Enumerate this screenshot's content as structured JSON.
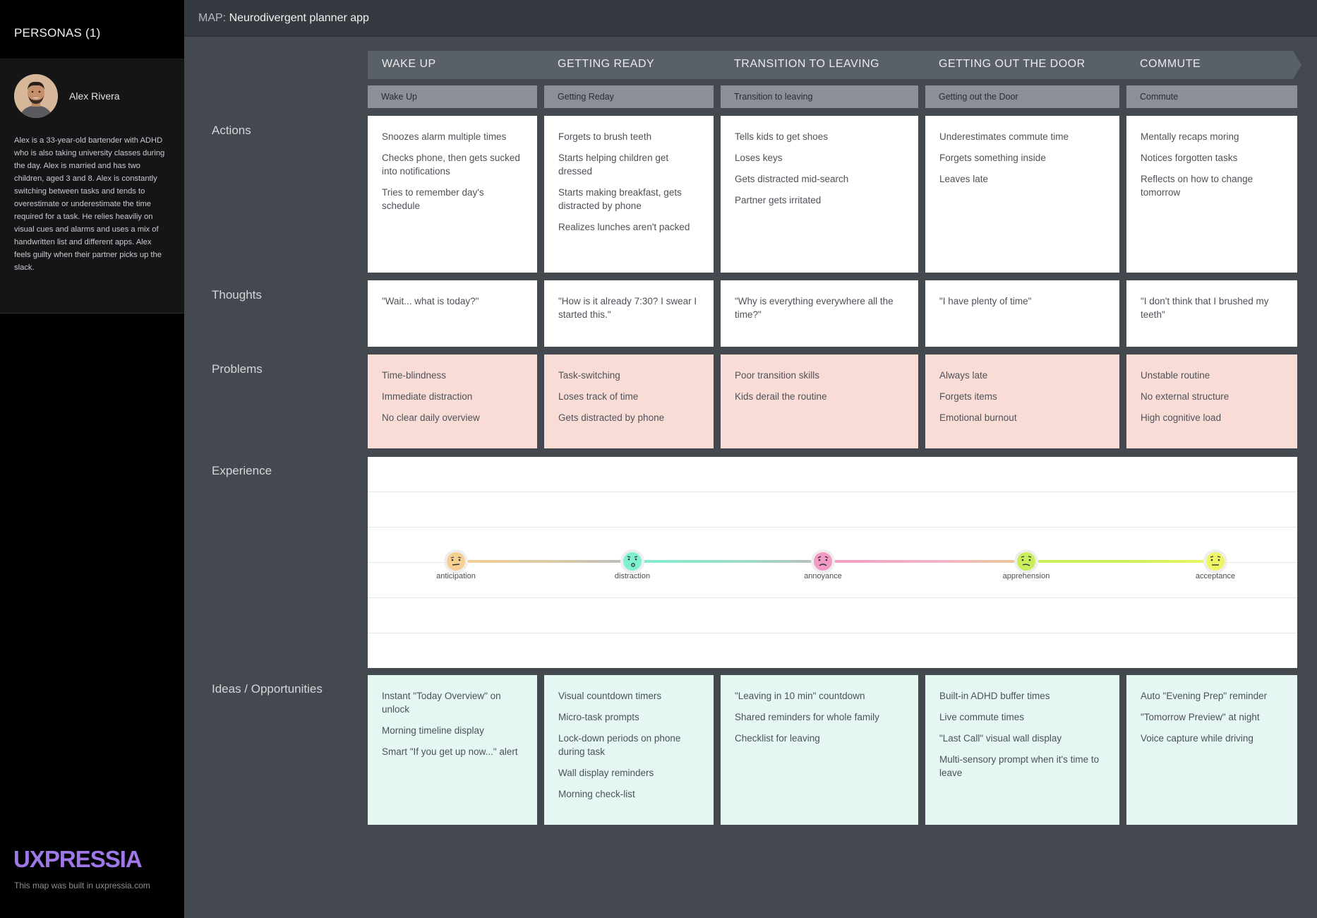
{
  "sidebar": {
    "title": "PERSONAS (1)",
    "persona": {
      "name": "Alex Rivera",
      "bio": "Alex is a 33-year-old bartender with ADHD who is also taking university classes during the day. Alex is married and has two children, aged 3 and 8. Alex is constantly switching between tasks and tends to overestimate or underestimate the time required for a task. He relies heaviliy on visual cues and alarms and uses a mix of handwritten list and different apps. Alex feels guilty when their partner picks up the slack."
    },
    "logo": "UXPRESSIA",
    "logo_sub": "This map was built in uxpressia.com"
  },
  "topbar": {
    "label": "MAP:",
    "name": "Neurodivergent planner app"
  },
  "stages": [
    {
      "title": "WAKE UP",
      "sub": "Wake Up"
    },
    {
      "title": "GETTING READY",
      "sub": "Getting Reday"
    },
    {
      "title": "TRANSITION TO LEAVING",
      "sub": "Transition to leaving"
    },
    {
      "title": "GETTING OUT THE DOOR",
      "sub": "Getting out the Door"
    },
    {
      "title": "COMMUTE",
      "sub": "Commute"
    }
  ],
  "rows": {
    "actions": {
      "label": "Actions",
      "cells": [
        [
          "Snoozes alarm multiple times",
          "Checks phone, then gets sucked into notifications",
          "Tries to remember day's schedule"
        ],
        [
          "Forgets to brush teeth",
          "Starts helping children get dressed",
          "Starts making breakfast, gets distracted by phone",
          "Realizes lunches aren't packed"
        ],
        [
          "Tells kids to get shoes",
          "Loses keys",
          "Gets distracted mid-search",
          "Partner gets irritated"
        ],
        [
          "Underestimates commute time",
          "Forgets something inside",
          "Leaves late"
        ],
        [
          "Mentally recaps moring",
          "Notices forgotten tasks",
          "Reflects on how to change tomorrow"
        ]
      ]
    },
    "thoughts": {
      "label": "Thoughts",
      "cells": [
        [
          "\"Wait... what is today?\""
        ],
        [
          "\"How is it already 7:30? I swear I started this.\""
        ],
        [
          "\"Why is everything everywhere all the time?\""
        ],
        [
          "\"I have plenty of time\""
        ],
        [
          "\"I don't think that I brushed my teeth\""
        ]
      ]
    },
    "problems": {
      "label": "Problems",
      "cells": [
        [
          "Time-blindness",
          "Immediate distraction",
          "No clear daily overview"
        ],
        [
          "Task-switching",
          "Loses track of time",
          "Gets distracted by phone"
        ],
        [
          "Poor transition skills",
          "Kids derail the routine"
        ],
        [
          "Always late",
          "Forgets items",
          "Emotional burnout"
        ],
        [
          "Unstable routine",
          "No external structure",
          "High cognitive load"
        ]
      ]
    },
    "experience": {
      "label": "Experience",
      "emotions": [
        {
          "label": "anticipation",
          "color": "#f5cf93"
        },
        {
          "label": "distraction",
          "color": "#7ef0d0"
        },
        {
          "label": "annoyance",
          "color": "#f39ac4"
        },
        {
          "label": "apprehension",
          "color": "#c8ee5a"
        },
        {
          "label": "acceptance",
          "color": "#eef567"
        }
      ]
    },
    "ideas": {
      "label": "Ideas / Opportunities",
      "cells": [
        [
          "Instant \"Today Overview\" on unlock",
          "Morning timeline display",
          "Smart \"If you get up now...\" alert"
        ],
        [
          "Visual countdown timers",
          "Micro-task prompts",
          "Lock-down periods on phone during task",
          "Wall display reminders",
          "Morning check-list"
        ],
        [
          "\"Leaving in 10 min\" countdown",
          "Shared reminders for whole family",
          "Checklist for leaving"
        ],
        [
          "Built-in ADHD buffer times",
          "Live commute times",
          "\"Last Call\" visual wall display",
          "Multi-sensory prompt when it's time to leave"
        ],
        [
          "Auto \"Evening Prep\" reminder",
          "\"Tomorrow Preview\" at night",
          "Voice capture while driving"
        ]
      ]
    }
  }
}
